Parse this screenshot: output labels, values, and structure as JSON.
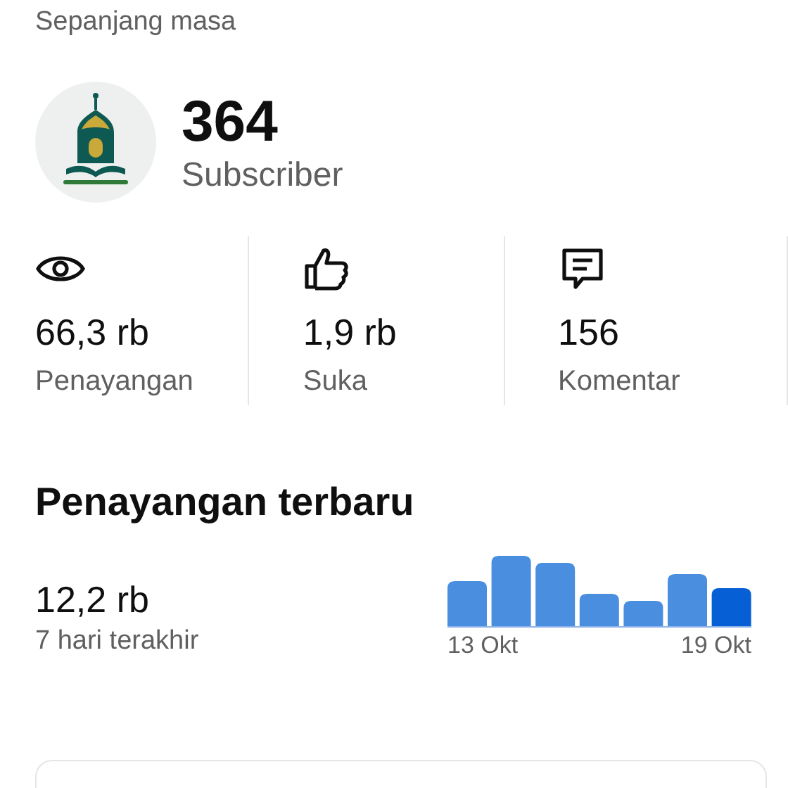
{
  "period": "Sepanjang masa",
  "channel": {
    "subscribers": "364",
    "subscribers_label": "Subscriber"
  },
  "stats": [
    {
      "kind": "views",
      "value": "66,3 rb",
      "label": "Penayangan"
    },
    {
      "kind": "likes",
      "value": "1,9 rb",
      "label": "Suka"
    },
    {
      "kind": "comments",
      "value": "156",
      "label": "Komentar"
    }
  ],
  "recent": {
    "title": "Penayangan terbaru",
    "value": "12,2 rb",
    "caption": "7 hari terakhir",
    "chart": {
      "start_label": "13 Okt",
      "end_label": "19 Okt"
    }
  }
}
